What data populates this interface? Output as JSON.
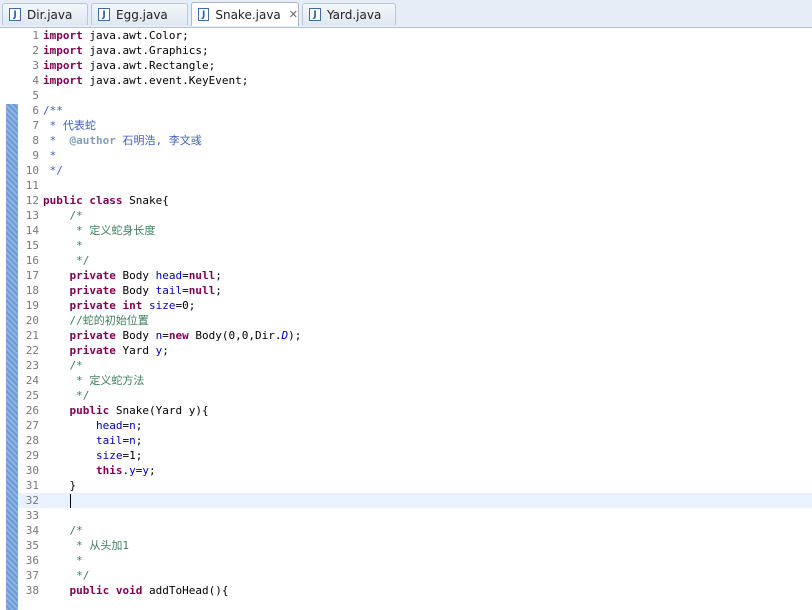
{
  "tabs": [
    {
      "label": "Dir.java",
      "active": false
    },
    {
      "label": "Egg.java",
      "active": false
    },
    {
      "label": "Snake.java",
      "active": true,
      "close": "✕"
    },
    {
      "label": "Yard.java",
      "active": false
    }
  ],
  "editor": {
    "current_line": 32,
    "lines": [
      {
        "n": "1",
        "t": "import java.awt.Color;"
      },
      {
        "n": "2",
        "t": "import java.awt.Graphics;"
      },
      {
        "n": "3",
        "t": "import java.awt.Rectangle;"
      },
      {
        "n": "4",
        "t": "import java.awt.event.KeyEvent;"
      },
      {
        "n": "5",
        "t": ""
      },
      {
        "n": "6",
        "t": "/**"
      },
      {
        "n": "7",
        "t": " * 代表蛇"
      },
      {
        "n": "8",
        "t": " *  @author 石明浩, 李文彧"
      },
      {
        "n": "9",
        "t": " *"
      },
      {
        "n": "10",
        "t": " */"
      },
      {
        "n": "11",
        "t": ""
      },
      {
        "n": "12",
        "t": "public class Snake{"
      },
      {
        "n": "13",
        "t": "    /*"
      },
      {
        "n": "14",
        "t": "     * 定义蛇身长度"
      },
      {
        "n": "15",
        "t": "     *"
      },
      {
        "n": "16",
        "t": "     */"
      },
      {
        "n": "17",
        "t": "    private Body head=null;"
      },
      {
        "n": "18",
        "t": "    private Body tail=null;"
      },
      {
        "n": "19",
        "t": "    private int size=0;"
      },
      {
        "n": "20",
        "t": "    //蛇的初始位置"
      },
      {
        "n": "21",
        "t": "    private Body n=new Body(0,0,Dir.D);"
      },
      {
        "n": "22",
        "t": "    private Yard y;"
      },
      {
        "n": "23",
        "t": "    /*"
      },
      {
        "n": "24",
        "t": "     * 定义蛇方法"
      },
      {
        "n": "25",
        "t": "     */"
      },
      {
        "n": "26",
        "t": "    public Snake(Yard y){"
      },
      {
        "n": "27",
        "t": "        head=n;"
      },
      {
        "n": "28",
        "t": "        tail=n;"
      },
      {
        "n": "29",
        "t": "        size=1;"
      },
      {
        "n": "30",
        "t": "        this.y=y;"
      },
      {
        "n": "31",
        "t": "    }"
      },
      {
        "n": "32",
        "t": "    "
      },
      {
        "n": "33",
        "t": ""
      },
      {
        "n": "34",
        "t": "    /*"
      },
      {
        "n": "35",
        "t": "     * 从头加1"
      },
      {
        "n": "36",
        "t": "     *"
      },
      {
        "n": "37",
        "t": "     */"
      },
      {
        "n": "38",
        "t": "    public void addToHead(){"
      }
    ]
  }
}
